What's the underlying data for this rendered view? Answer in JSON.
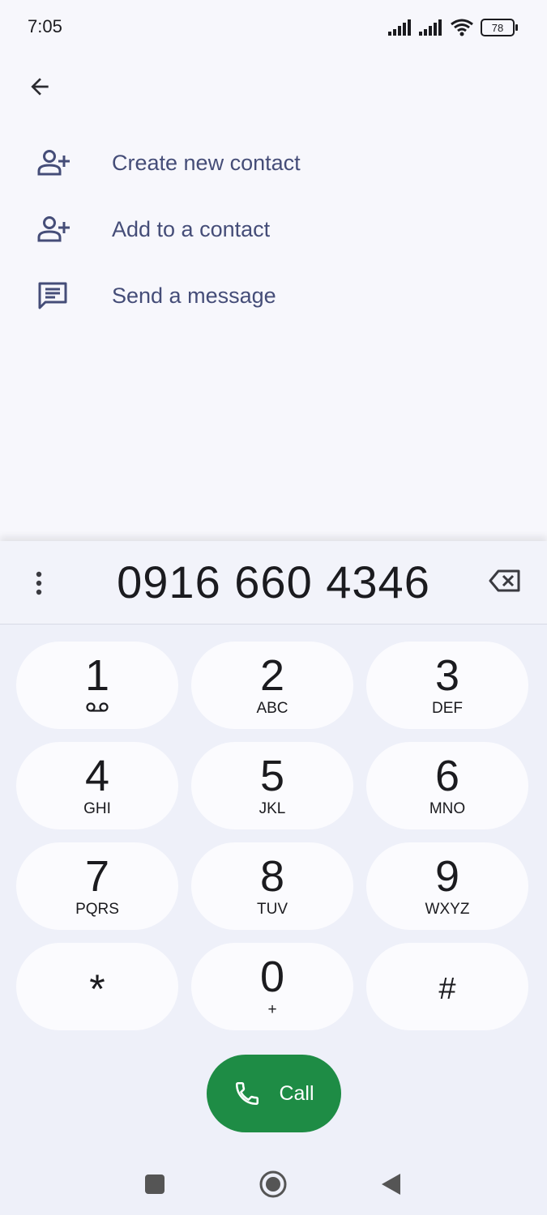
{
  "status_bar": {
    "time": "7:05",
    "battery": "78"
  },
  "menu": {
    "items": [
      {
        "label": "Create new contact",
        "icon": "add-person-icon"
      },
      {
        "label": "Add to a contact",
        "icon": "add-person-icon"
      },
      {
        "label": "Send a message",
        "icon": "message-icon"
      }
    ]
  },
  "dialer": {
    "digits": "0916 660 4346",
    "keys": [
      {
        "num": "1",
        "sub": "",
        "extra_icon": "voicemail-icon"
      },
      {
        "num": "2",
        "sub": "ABC"
      },
      {
        "num": "3",
        "sub": "DEF"
      },
      {
        "num": "4",
        "sub": "GHI"
      },
      {
        "num": "5",
        "sub": "JKL"
      },
      {
        "num": "6",
        "sub": "MNO"
      },
      {
        "num": "7",
        "sub": "PQRS"
      },
      {
        "num": "8",
        "sub": "TUV"
      },
      {
        "num": "9",
        "sub": "WXYZ"
      },
      {
        "num": "*",
        "sub": ""
      },
      {
        "num": "0",
        "sub": "+"
      },
      {
        "num": "#",
        "sub": ""
      }
    ],
    "call_label": "Call"
  },
  "colors": {
    "accent": "#1e8c45",
    "menu_text": "#454d78",
    "background": "#f7f7fc"
  }
}
